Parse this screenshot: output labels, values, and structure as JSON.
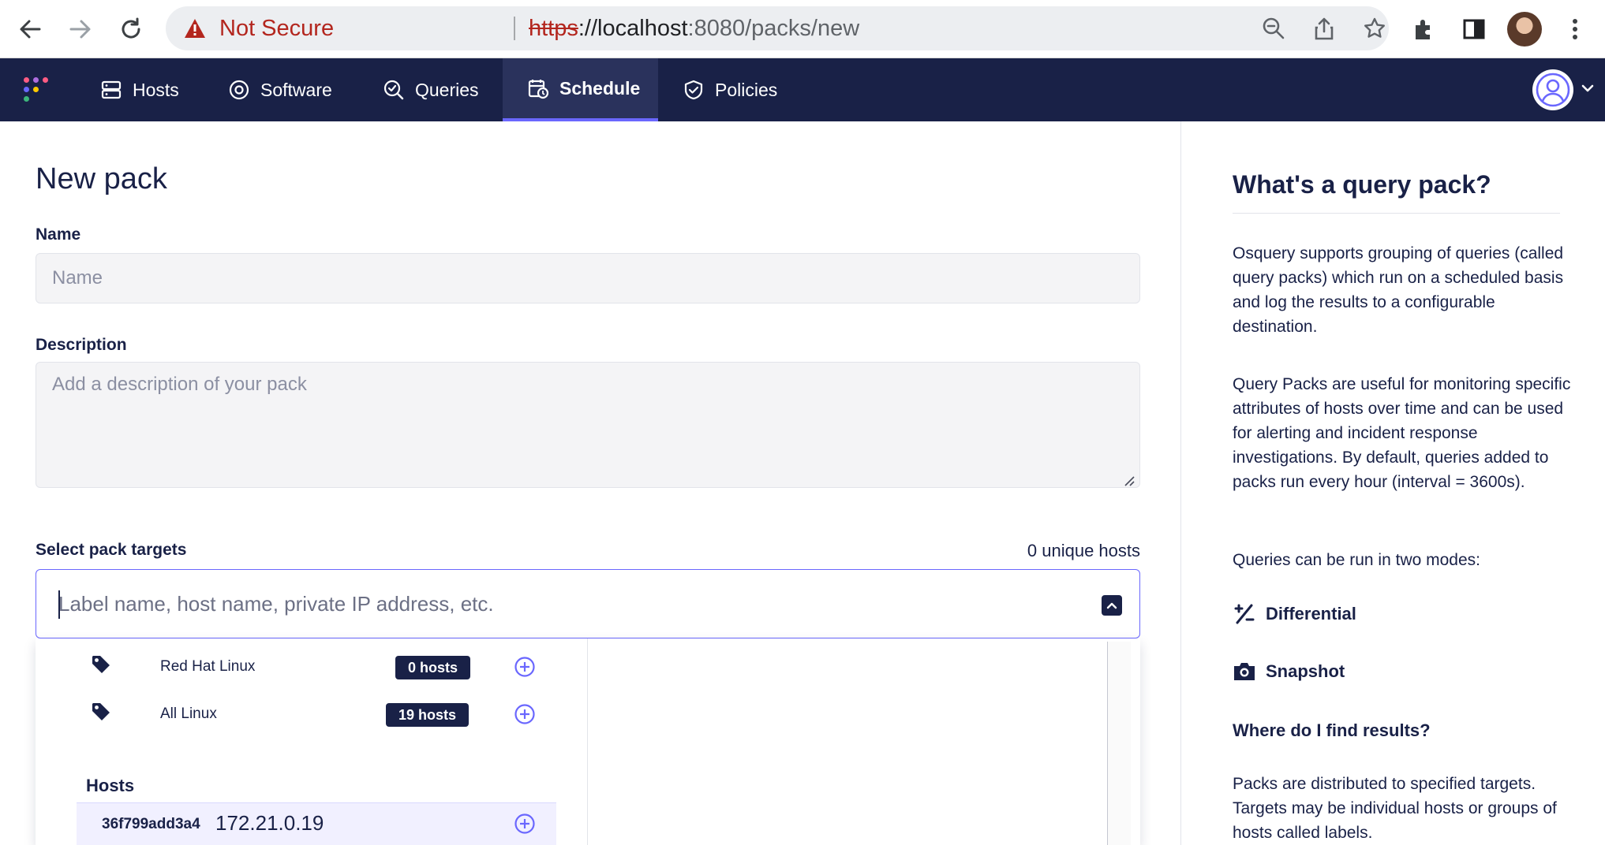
{
  "browser": {
    "security_label": "Not Secure",
    "url_scheme": "https",
    "url_host": "://localhost",
    "url_rest": ":8080/packs/new"
  },
  "nav": {
    "items": [
      {
        "label": "Hosts",
        "icon": "hosts-icon"
      },
      {
        "label": "Software",
        "icon": "software-icon"
      },
      {
        "label": "Queries",
        "icon": "queries-icon"
      },
      {
        "label": "Schedule",
        "icon": "schedule-icon",
        "active": true
      },
      {
        "label": "Policies",
        "icon": "policies-icon"
      }
    ],
    "accent": "#6a67fe",
    "background": "#192147"
  },
  "form": {
    "title": "New pack",
    "name_label": "Name",
    "name_placeholder": "Name",
    "description_label": "Description",
    "description_placeholder": "Add a description of your pack",
    "targets_label": "Select pack targets",
    "unique_hosts": "0 unique hosts",
    "targets_placeholder": "Label name, host name, private IP address, etc."
  },
  "dropdown": {
    "labels": [
      {
        "name": "Red Hat Linux",
        "count": "0 hosts"
      },
      {
        "name": "All Linux",
        "count": "19 hosts"
      }
    ],
    "hosts_heading": "Hosts",
    "hosts": [
      {
        "id": "36f799add3a4",
        "ip": "172.21.0.19"
      }
    ]
  },
  "sidebar": {
    "title": "What's a query pack?",
    "para1": "Osquery supports grouping of queries (called query packs) which run on a scheduled basis and log the results to a configurable destination.",
    "para2": "Query Packs are useful for monitoring specific attributes of hosts over time and can be used for alerting and incident response investigations. By default, queries added to packs run every hour (interval = 3600s).",
    "para3": "Queries can be run in two modes:",
    "mode_differential": "Differential",
    "mode_snapshot": "Snapshot",
    "results_heading": "Where do I find results?",
    "para4": "Packs are distributed to specified targets. Targets may be individual hosts or groups of hosts called labels."
  }
}
